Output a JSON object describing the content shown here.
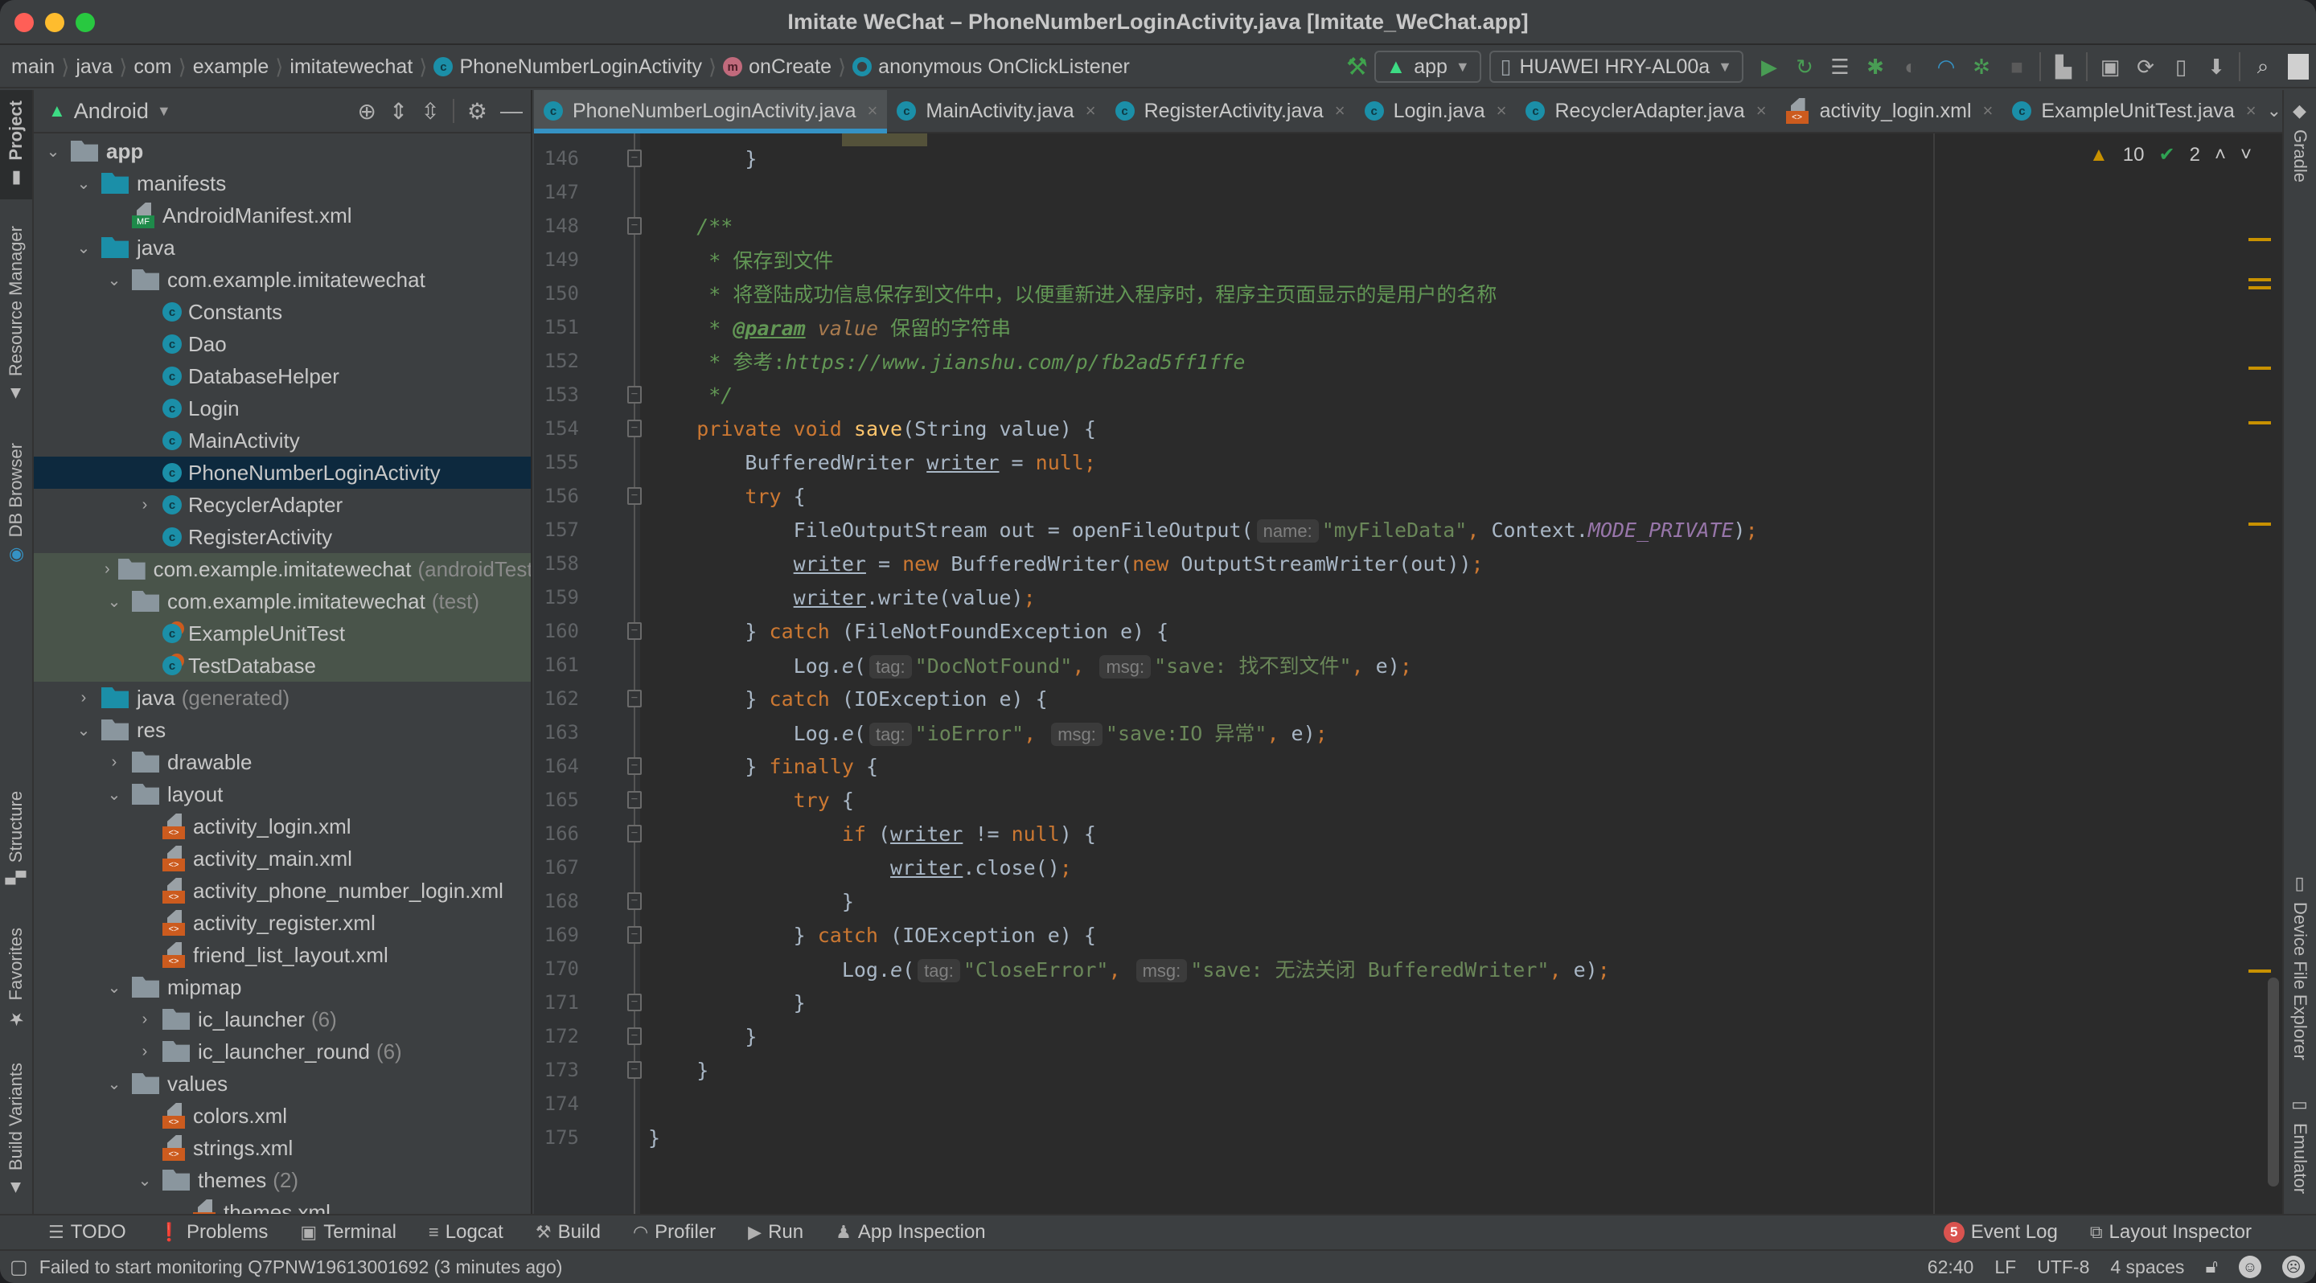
{
  "window": {
    "title": "Imitate WeChat – PhoneNumberLoginActivity.java [Imitate_WeChat.app]"
  },
  "breadcrumbs": [
    {
      "label": "main",
      "icon": null
    },
    {
      "label": "java",
      "icon": null
    },
    {
      "label": "com",
      "icon": null
    },
    {
      "label": "example",
      "icon": null
    },
    {
      "label": "imitatewechat",
      "icon": null
    },
    {
      "label": "PhoneNumberLoginActivity",
      "icon": "class-icon"
    },
    {
      "label": "onCreate",
      "icon": "method-icon"
    },
    {
      "label": "anonymous OnClickListener",
      "icon": "anonymous-class-icon"
    }
  ],
  "toolbar": {
    "run_config": "app",
    "device": "HUAWEI HRY-AL00a"
  },
  "left_stripe": [
    "Project",
    "Resource Manager",
    "DB Browser",
    "Structure",
    "Favorites",
    "Build Variants"
  ],
  "right_stripe": [
    "Gradle",
    "Device File Explorer",
    "Emulator"
  ],
  "project_panel": {
    "view_mode": "Android",
    "tree": [
      {
        "label": "app",
        "depth": 0,
        "expanded": true,
        "icon": "module",
        "bold": true
      },
      {
        "label": "manifests",
        "depth": 1,
        "expanded": true,
        "icon": "folder-blue"
      },
      {
        "label": "AndroidManifest.xml",
        "depth": 2,
        "icon": "manifest"
      },
      {
        "label": "java",
        "depth": 1,
        "expanded": true,
        "icon": "folder-blue"
      },
      {
        "label": "com.example.imitatewechat",
        "depth": 2,
        "expanded": true,
        "icon": "package"
      },
      {
        "label": "Constants",
        "depth": 3,
        "icon": "class"
      },
      {
        "label": "Dao",
        "depth": 3,
        "icon": "class"
      },
      {
        "label": "DatabaseHelper",
        "depth": 3,
        "icon": "class"
      },
      {
        "label": "Login",
        "depth": 3,
        "icon": "class"
      },
      {
        "label": "MainActivity",
        "depth": 3,
        "icon": "class"
      },
      {
        "label": "PhoneNumberLoginActivity",
        "depth": 3,
        "icon": "class",
        "selected": true
      },
      {
        "label": "RecyclerAdapter",
        "depth": 3,
        "expanded": false,
        "icon": "class"
      },
      {
        "label": "RegisterActivity",
        "depth": 3,
        "icon": "class"
      },
      {
        "label": "com.example.imitatewechat",
        "suffix": "(androidTest)",
        "depth": 2,
        "expanded": false,
        "icon": "package",
        "test": true
      },
      {
        "label": "com.example.imitatewechat",
        "suffix": "(test)",
        "depth": 2,
        "expanded": true,
        "icon": "package",
        "test": true
      },
      {
        "label": "ExampleUnitTest",
        "depth": 3,
        "icon": "test-class",
        "test": true
      },
      {
        "label": "TestDatabase",
        "depth": 3,
        "icon": "test-class",
        "test": true
      },
      {
        "label": "java",
        "suffix": "(generated)",
        "depth": 1,
        "expanded": false,
        "icon": "folder-generated"
      },
      {
        "label": "res",
        "depth": 1,
        "expanded": true,
        "icon": "folder-res"
      },
      {
        "label": "drawable",
        "depth": 2,
        "expanded": false,
        "icon": "package"
      },
      {
        "label": "layout",
        "depth": 2,
        "expanded": true,
        "icon": "package"
      },
      {
        "label": "activity_login.xml",
        "depth": 3,
        "icon": "xml"
      },
      {
        "label": "activity_main.xml",
        "depth": 3,
        "icon": "xml"
      },
      {
        "label": "activity_phone_number_login.xml",
        "depth": 3,
        "icon": "xml"
      },
      {
        "label": "activity_register.xml",
        "depth": 3,
        "icon": "xml"
      },
      {
        "label": "friend_list_layout.xml",
        "depth": 3,
        "icon": "xml"
      },
      {
        "label": "mipmap",
        "depth": 2,
        "expanded": true,
        "icon": "package"
      },
      {
        "label": "ic_launcher",
        "suffix": "(6)",
        "depth": 3,
        "expanded": false,
        "icon": "package"
      },
      {
        "label": "ic_launcher_round",
        "suffix": "(6)",
        "depth": 3,
        "expanded": false,
        "icon": "package"
      },
      {
        "label": "values",
        "depth": 2,
        "expanded": true,
        "icon": "package"
      },
      {
        "label": "colors.xml",
        "depth": 3,
        "icon": "xml"
      },
      {
        "label": "strings.xml",
        "depth": 3,
        "icon": "xml"
      },
      {
        "label": "themes",
        "suffix": "(2)",
        "depth": 3,
        "expanded": true,
        "icon": "package"
      },
      {
        "label": "themes.xml",
        "depth": 4,
        "icon": "xml"
      }
    ]
  },
  "editor_tabs": [
    {
      "label": "PhoneNumberLoginActivity.java",
      "icon": "class",
      "active": true
    },
    {
      "label": "MainActivity.java",
      "icon": "class"
    },
    {
      "label": "RegisterActivity.java",
      "icon": "class"
    },
    {
      "label": "Login.java",
      "icon": "class"
    },
    {
      "label": "RecyclerAdapter.java",
      "icon": "class"
    },
    {
      "label": "activity_login.xml",
      "icon": "xml"
    },
    {
      "label": "ExampleUnitTest.java",
      "icon": "test-class"
    }
  ],
  "inspections": {
    "warnings": "10",
    "weak_warnings": "2"
  },
  "code": {
    "line_numbers": [
      "146",
      "147",
      "148",
      "149",
      "150",
      "151",
      "152",
      "153",
      "154",
      "155",
      "156",
      "157",
      "158",
      "159",
      "160",
      "161",
      "162",
      "163",
      "164",
      "165",
      "166",
      "167",
      "168",
      "169",
      "170",
      "171",
      "172",
      "173",
      "174",
      "175"
    ],
    "comment_title": "保存到文件",
    "comment_desc": "将登陆成功信息保存到文件中，以便重新进入程序时，程序主页面显示的是用户的名称",
    "comment_param_tag": "@param",
    "comment_param_name": "value",
    "comment_param_desc": "保留的字符串",
    "comment_ref_label": "参考:",
    "comment_ref_url": "https://www.jianshu.com/p/fb2ad5ff1ffe",
    "method_name": "save",
    "file_name_str": "\"myFileData\"",
    "mode_const": "MODE_PRIVATE",
    "tag1": "\"DocNotFound\"",
    "msg1": "\"save: 找不到文件\"",
    "tag2": "\"ioError\"",
    "msg2": "\"save:IO 异常\"",
    "tag3": "\"CloseError\"",
    "msg3": "\"save: 无法关闭 BufferedWriter\"",
    "hint_name": "name:",
    "hint_tag": "tag:",
    "hint_msg": "msg:"
  },
  "bottom_tools": [
    {
      "label": "TODO",
      "icon": "list-icon"
    },
    {
      "label": "Problems",
      "icon": "problems-icon"
    },
    {
      "label": "Terminal",
      "icon": "terminal-icon"
    },
    {
      "label": "Logcat",
      "icon": "logcat-icon"
    },
    {
      "label": "Build",
      "icon": "hammer-icon"
    },
    {
      "label": "Profiler",
      "icon": "gauge-icon"
    },
    {
      "label": "Run",
      "icon": "play-icon"
    },
    {
      "label": "App Inspection",
      "icon": "inspection-icon"
    }
  ],
  "bottom_right_tools": {
    "event_log": "Event Log",
    "event_log_count": "5",
    "layout_inspector": "Layout Inspector"
  },
  "status": {
    "message": "Failed to start monitoring Q7PNW19613001692 (3 minutes ago)",
    "position": "62:40",
    "line_ending": "LF",
    "encoding": "UTF-8",
    "indent": "4 spaces"
  },
  "colors": {
    "accent": "#3592c4",
    "selection": "#0d293e",
    "keyword": "#cc7832",
    "string": "#6a8759",
    "comment": "#629755",
    "warning": "#c89100"
  }
}
